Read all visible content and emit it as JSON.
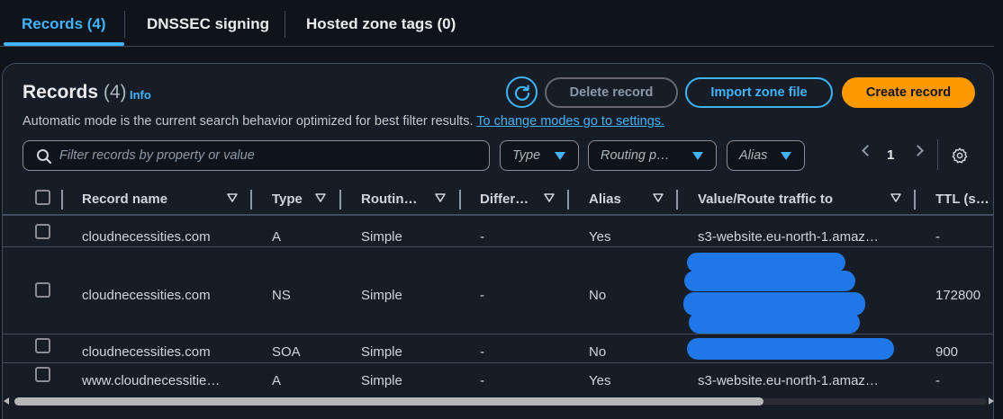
{
  "tabs": [
    {
      "label": "Records (4)",
      "active": true
    },
    {
      "label": "DNSSEC signing",
      "active": false
    },
    {
      "label": "Hosted zone tags (0)",
      "active": false
    }
  ],
  "panel": {
    "title": "Records",
    "count": "(4)",
    "info": "Info",
    "description": "Automatic mode is the current search behavior optimized for best filter results.",
    "description_link": "To change modes go to settings."
  },
  "actions": {
    "refresh_icon": "refresh-icon",
    "delete": "Delete record",
    "import": "Import zone file",
    "create": "Create record"
  },
  "filters": {
    "search_placeholder": "Filter records by property or value",
    "type": "Type",
    "routing": "Routing p…",
    "alias": "Alias"
  },
  "pagination": {
    "page": "1"
  },
  "table": {
    "columns": [
      "Record name",
      "Type",
      "Routin…",
      "Differ…",
      "Alias",
      "Value/Route traffic to",
      "TTL (s…"
    ],
    "rows": [
      {
        "name": "cloudnecessities.com",
        "type": "A",
        "routing": "Simple",
        "differ": "-",
        "alias": "Yes",
        "value": "s3-website.eu-north-1.amaz…",
        "ttl": "-"
      },
      {
        "name": "cloudnecessities.com",
        "type": "NS",
        "routing": "Simple",
        "differ": "-",
        "alias": "No",
        "value": "",
        "ttl": "172800"
      },
      {
        "name": "cloudnecessities.com",
        "type": "SOA",
        "routing": "Simple",
        "differ": "-",
        "alias": "No",
        "value": "",
        "ttl": "900"
      },
      {
        "name": "www.cloudnecessitie…",
        "type": "A",
        "routing": "Simple",
        "differ": "-",
        "alias": "Yes",
        "value": "s3-website.eu-north-1.amaz…",
        "ttl": "-"
      }
    ]
  },
  "colors": {
    "accent": "#42b4ff",
    "primary": "#ff9900",
    "redaction": "#1f77e8",
    "background": "#0f141a"
  }
}
